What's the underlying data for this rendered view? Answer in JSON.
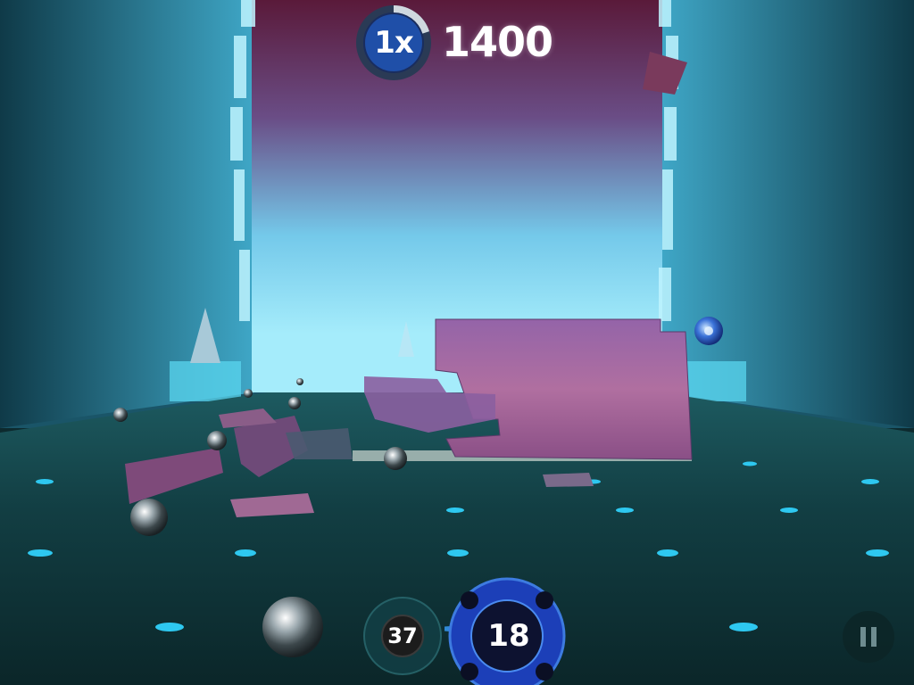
{
  "hud": {
    "multiplier": "1x",
    "multiplier_progress": 0.2,
    "score": "1400",
    "score_color": "#ffffff",
    "ring_color": "#1f4fa8"
  },
  "balls": {
    "secondary_count": "37",
    "main_count": "18",
    "main_color": "#1c3fb8"
  },
  "icons": {
    "pause": "pause-icon",
    "power_ball": "chrome-ball-icon"
  },
  "colors": {
    "sky_top": "#5a1a3a",
    "sky_glow": "#5ad0f0",
    "floor": "#0e2f33",
    "floor_dots": "#2ec8f0",
    "glass_obstacle": "#8a5a9e"
  }
}
